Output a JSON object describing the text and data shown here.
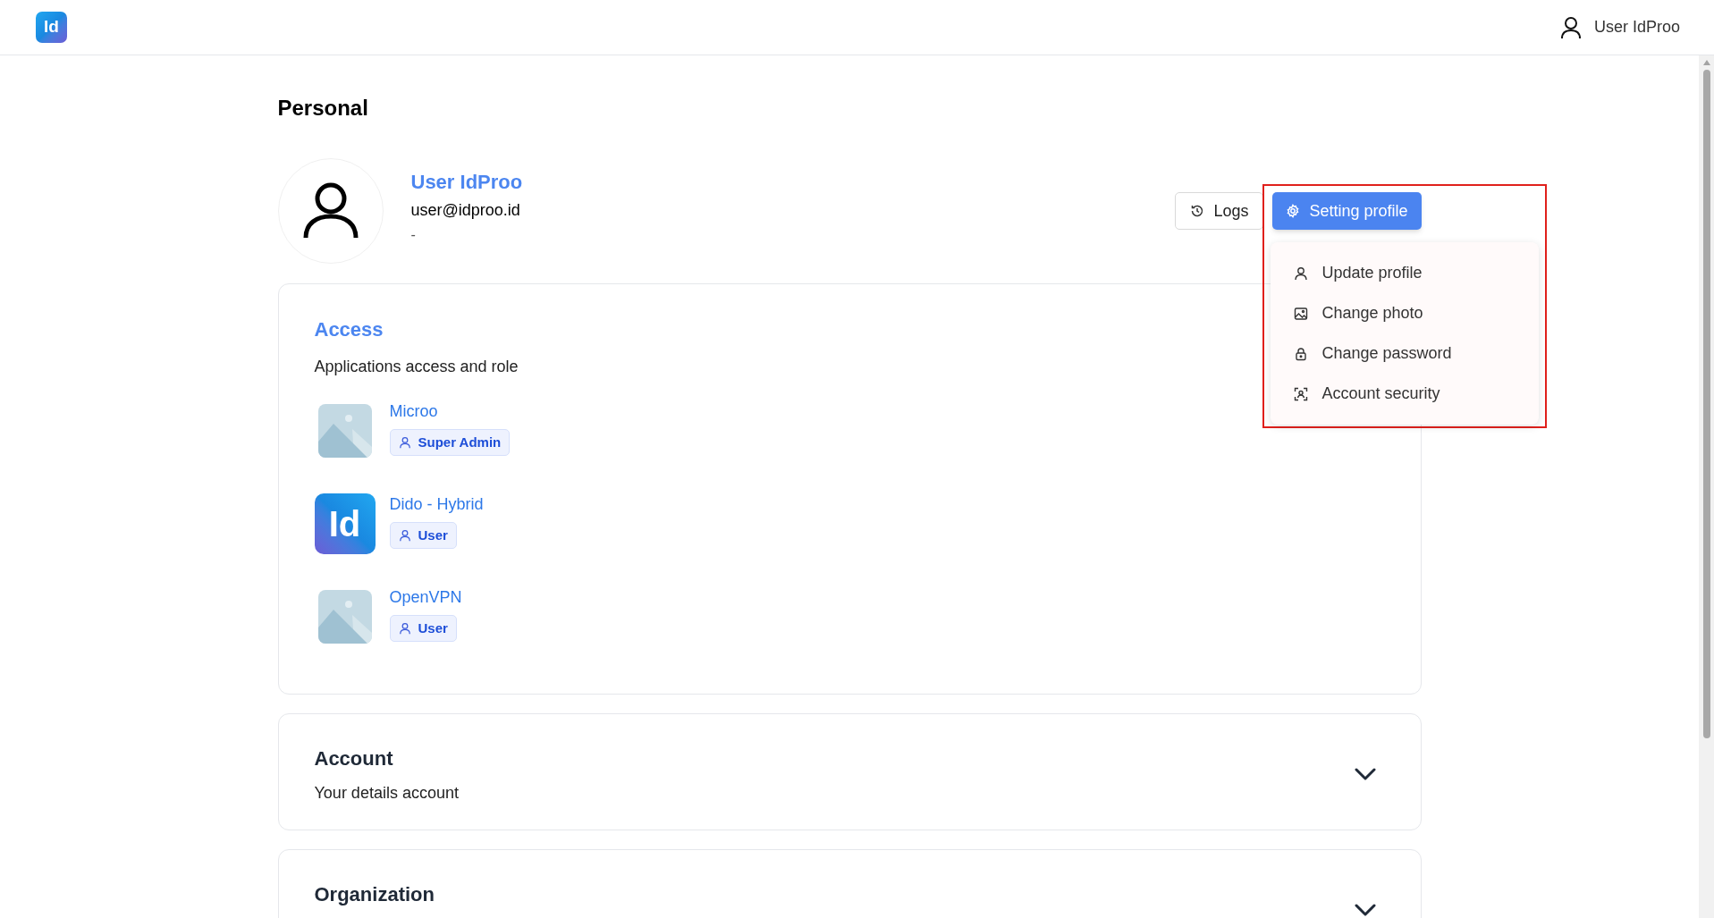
{
  "header": {
    "logo": "Id",
    "user": "User IdProo"
  },
  "page_title": "Personal",
  "profile": {
    "name": "User IdProo",
    "email": "user@idproo.id",
    "note": "-"
  },
  "actions": [
    {
      "label": "Logs",
      "kind": "outline"
    },
    {
      "label": "Setting profile",
      "kind": "primary"
    }
  ],
  "settings_menu": {
    "expanded": true,
    "items": [
      {
        "label": "Update profile"
      },
      {
        "label": "Change photo"
      },
      {
        "label": "Change password"
      },
      {
        "label": "Account security"
      }
    ]
  },
  "access": {
    "title": "Access",
    "subtitle": "Applications access and role",
    "apps": [
      {
        "name": "Microo",
        "role": "Super Admin",
        "kind": "picture"
      },
      {
        "name": "Dido - Hybrid",
        "role": "User",
        "kind": "logo",
        "logo": "Id"
      },
      {
        "name": "OpenVPN",
        "role": "User",
        "kind": "picture"
      }
    ]
  },
  "sections": [
    {
      "title": "Account",
      "subtitle": "Your details account",
      "expanded": false
    },
    {
      "title": "Organization",
      "expanded": false
    }
  ]
}
